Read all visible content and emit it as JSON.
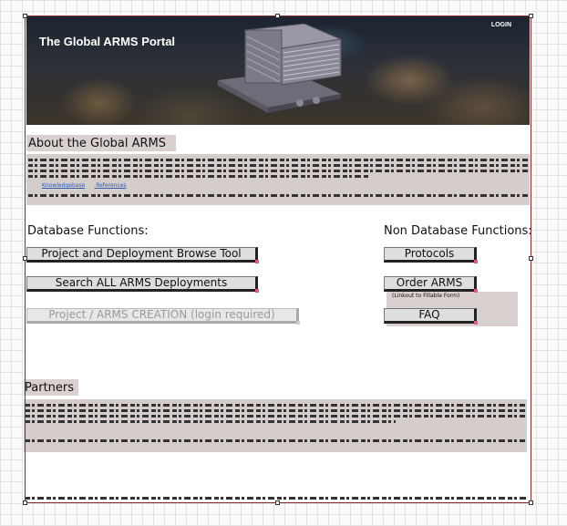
{
  "banner": {
    "title": "The Global ARMS Portal",
    "login_label": "LOGIN"
  },
  "about": {
    "heading": "About the Global ARMS",
    "links": [
      "Knowledgebase",
      "References"
    ]
  },
  "database": {
    "heading": "Database Functions:",
    "buttons": [
      "Project and Deployment Browse Tool",
      "Search ALL ARMS Deployments",
      "Project / ARMS CREATION (login required)"
    ]
  },
  "non_database": {
    "heading": "Non Database Functions:",
    "buttons": [
      "Protocols",
      "Order ARMS",
      "FAQ"
    ],
    "note": "(Linkout to Fillable Form)"
  },
  "partners": {
    "heading": "Partners"
  },
  "colors": {
    "selection_border": "#8b2a2a",
    "text_box_background": "#d5cccc",
    "button_corner_marker": "#e15a88"
  }
}
